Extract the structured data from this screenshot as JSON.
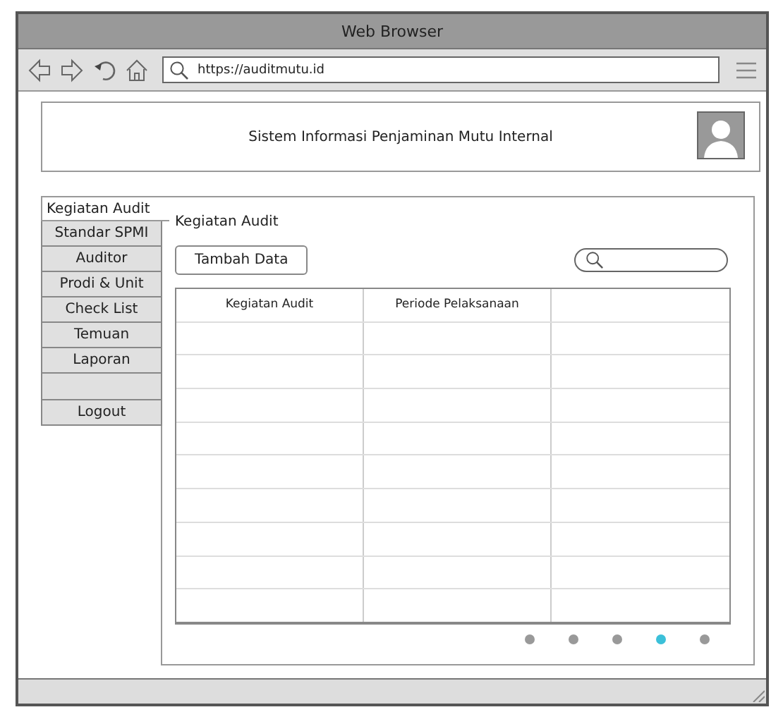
{
  "window": {
    "title": "Web Browser"
  },
  "address_bar": {
    "value": "https://auditmutu.id"
  },
  "header": {
    "title": "Sistem Informasi Penjaminan Mutu Internal"
  },
  "sidebar": {
    "items": [
      {
        "kind": "tab",
        "label": "Kegiatan Audit",
        "selected": true
      },
      {
        "kind": "tab",
        "label": "Standar SPMI",
        "selected": false
      },
      {
        "kind": "tab",
        "label": "Auditor",
        "selected": false
      },
      {
        "kind": "tab",
        "label": "Prodi & Unit",
        "selected": false
      },
      {
        "kind": "tab",
        "label": "Check List",
        "selected": false
      },
      {
        "kind": "tab",
        "label": "Temuan",
        "selected": false
      },
      {
        "kind": "tab",
        "label": "Laporan",
        "selected": false
      },
      {
        "kind": "spacer"
      },
      {
        "kind": "tab",
        "label": "Logout",
        "selected": false
      }
    ]
  },
  "panel": {
    "title": "Kegiatan Audit",
    "add_button": "Tambah Data",
    "table": {
      "columns": [
        "Kegiatan Audit",
        "Periode Pelaksanaan"
      ]
    },
    "pagination": [
      {
        "selected": false
      },
      {
        "selected": false
      },
      {
        "selected": false
      },
      {
        "selected": true
      },
      {
        "selected": false
      }
    ]
  }
}
